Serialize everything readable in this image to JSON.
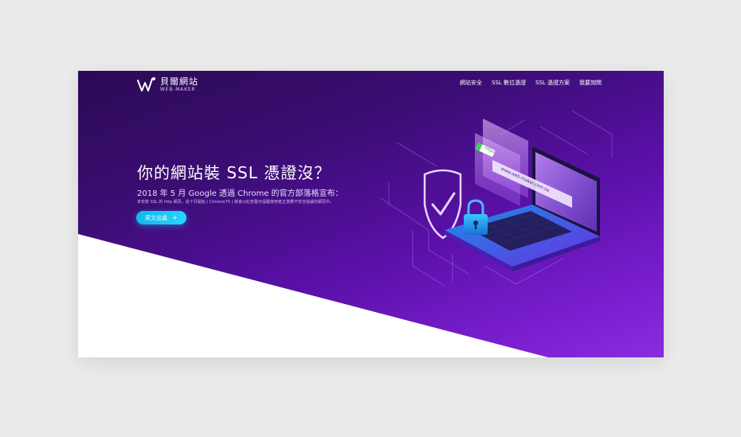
{
  "brand": {
    "name_cn": "貝爾網站",
    "name_en": "WEB-MAKER"
  },
  "nav": {
    "items": [
      {
        "label": "網站安全"
      },
      {
        "label": "SSL 數位憑證"
      },
      {
        "label": "SSL 憑證方案"
      },
      {
        "label": "我要詢問"
      }
    ]
  },
  "hero": {
    "title": "你的網站裝 SSL 憑證沒？",
    "subtitle": "2018 年 5 月 Google 透過 Chrome 的官方部落格宣布：",
    "description": "未安裝 SSL 的 http 網頁，從十月開始 ( Chrome70 ) 將會以紅色警示提醒使用者正瀏覽不安全疑慮的網頁中。",
    "cta_label": "原文出處",
    "cta_icon": "+"
  },
  "illustration": {
    "address_bar_text": "www.web-maker.com.tw",
    "https_badge": "https"
  },
  "colors": {
    "page_bg": "#ebebec",
    "hero_dark": "#2c0a55",
    "hero_light": "#8a2be0",
    "accent_cyan": "#2ad4ff",
    "https_green": "#39d353"
  }
}
